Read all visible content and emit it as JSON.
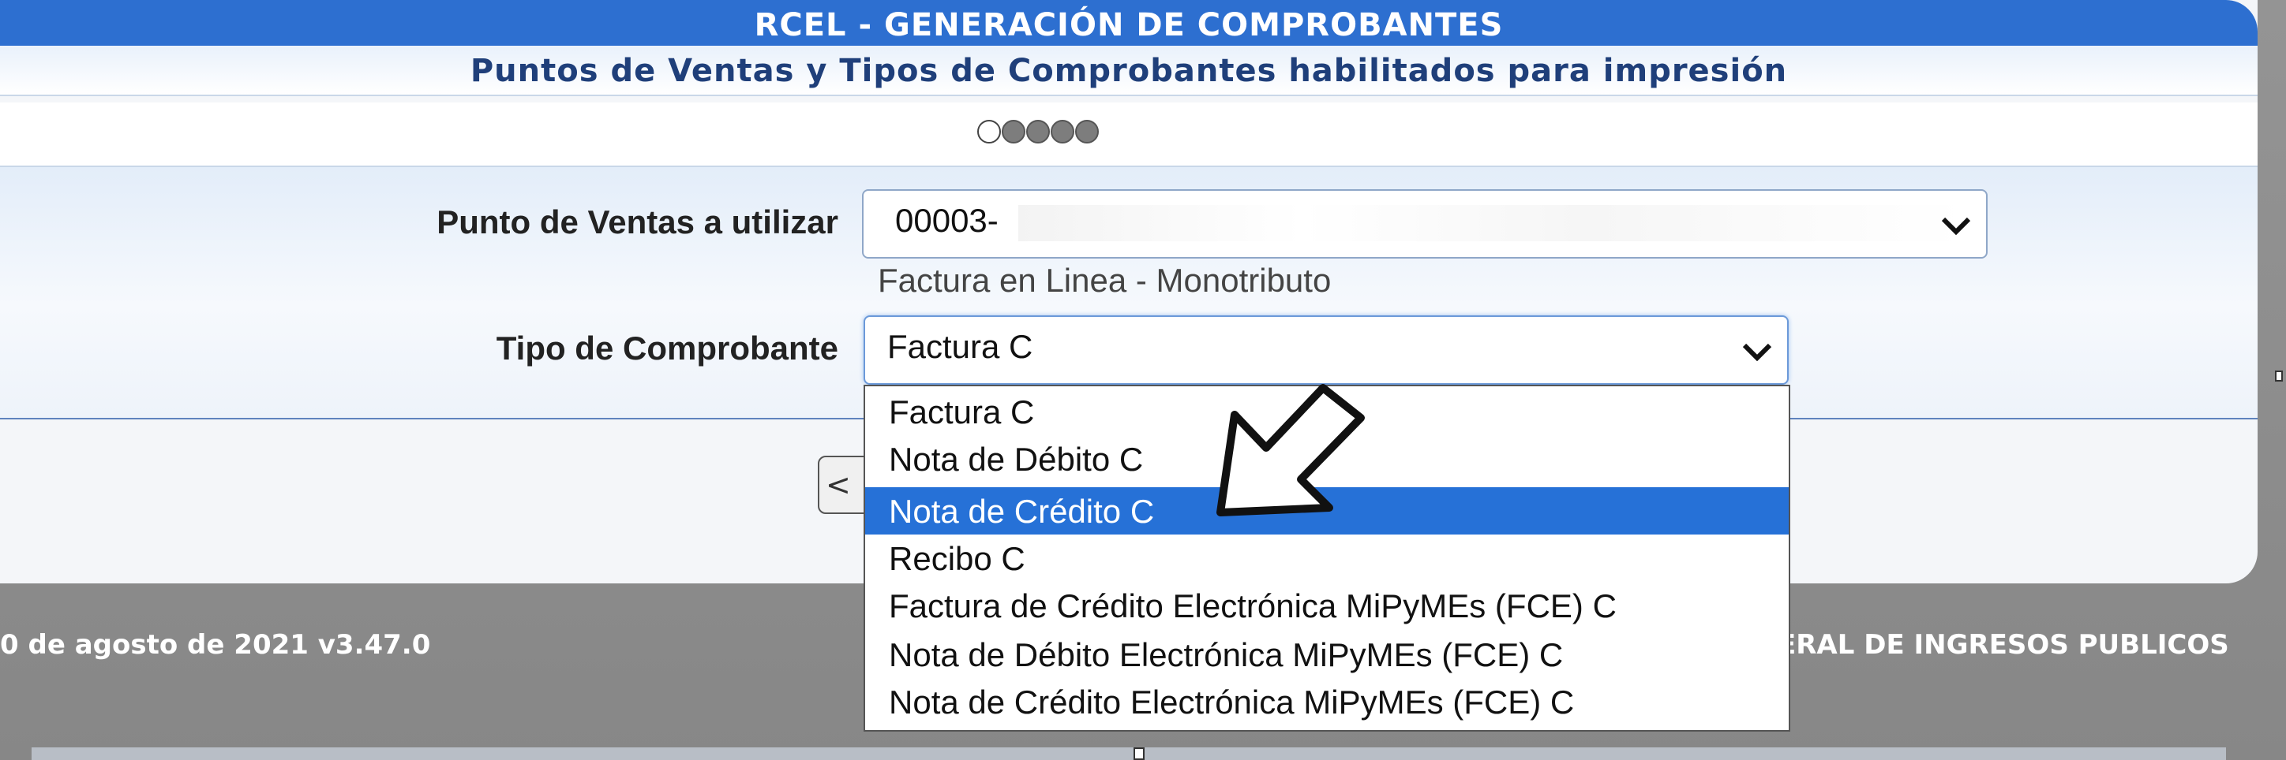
{
  "header": {
    "title": "RCEL - GENERACIÓN DE COMPROBANTES",
    "subtitle": "Puntos de Ventas y Tipos de Comprobantes habilitados para impresión"
  },
  "wizard": {
    "total_steps": 5,
    "current_step": 1
  },
  "form": {
    "punto_label": "Punto de Ventas a utilizar",
    "punto_value": "00003-",
    "punto_info": "Factura en Linea - Monotributo",
    "tipo_label": "Tipo de Comprobante",
    "tipo_value": "Factura C"
  },
  "dropdown": {
    "options": [
      "Factura C",
      "Nota de Débito C",
      "Nota de Crédito C",
      "Recibo C",
      "Factura de Crédito Electrónica MiPyMEs (FCE) C",
      "Nota de Débito Electrónica MiPyMEs (FCE) C",
      "Nota de Crédito Electrónica MiPyMEs (FCE) C"
    ],
    "highlighted_index": 2
  },
  "back_button": {
    "label": "<"
  },
  "footer": {
    "left": "0 de agosto de 2021 v3.47.0",
    "right": "ERAL DE INGRESOS PUBLICOS"
  },
  "colors": {
    "title_bar": "#2d6fd0",
    "highlight": "#2671d7",
    "subtitle_text": "#1f3f7a"
  }
}
